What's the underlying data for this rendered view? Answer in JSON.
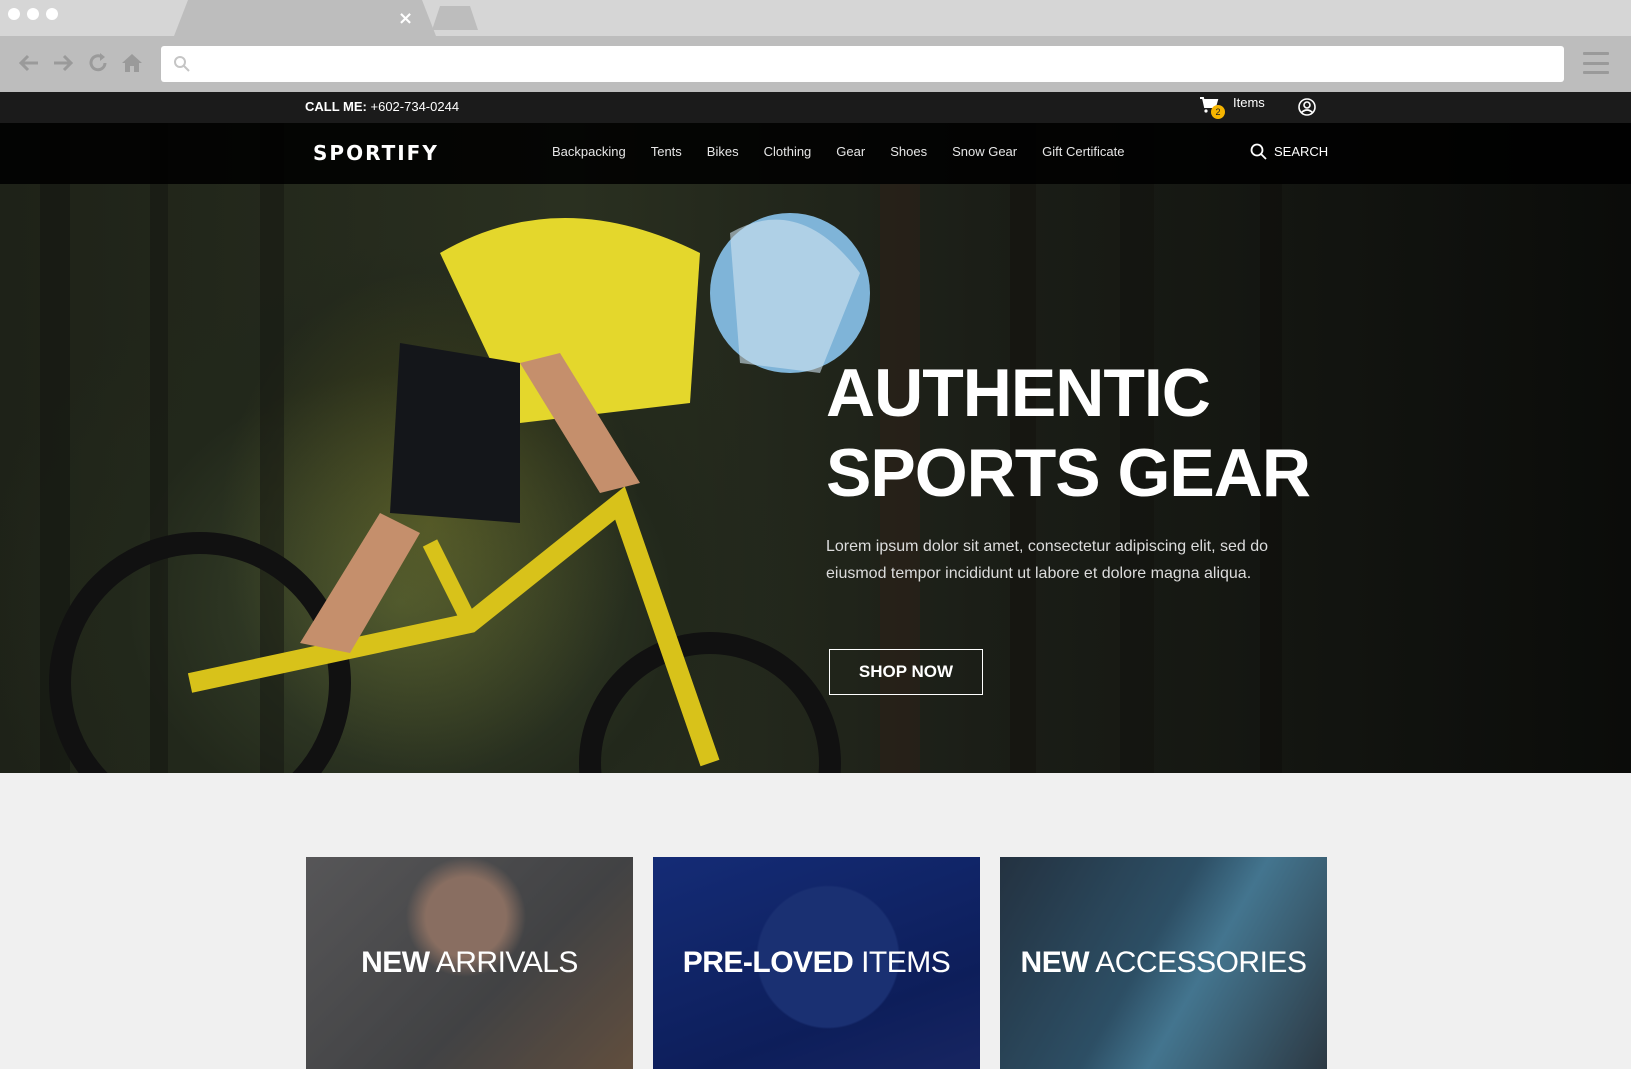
{
  "browser": {
    "tab_close": "×"
  },
  "topbar": {
    "call_label": "CALL ME:",
    "phone": "+602-734-0244",
    "cart_count": "2",
    "cart_label": "Items"
  },
  "nav": {
    "logo": "SPORTIFY",
    "items": [
      "Backpacking",
      "Tents",
      "Bikes",
      "Clothing",
      "Gear",
      "Shoes",
      "Snow Gear",
      "Gift Certificate"
    ],
    "search_label": "SEARCH"
  },
  "hero": {
    "title_line1": "AUTHENTIC",
    "title_line2": "SPORTS GEAR",
    "subtitle": "Lorem ipsum dolor sit amet, consectetur adipiscing elit, sed do eiusmod tempor incididunt ut labore et dolore magna aliqua.",
    "cta": "SHOP NOW"
  },
  "cards": [
    {
      "strong": "NEW",
      "light": " ARRIVALS"
    },
    {
      "strong": "PRE-LOVED",
      "light": " ITEMS"
    },
    {
      "strong": "NEW",
      "light": " ACCESSORIES"
    }
  ],
  "colors": {
    "topbar_bg": "#1b1b1b",
    "badge": "#f5b400",
    "page_bg": "#f0f0f0"
  }
}
